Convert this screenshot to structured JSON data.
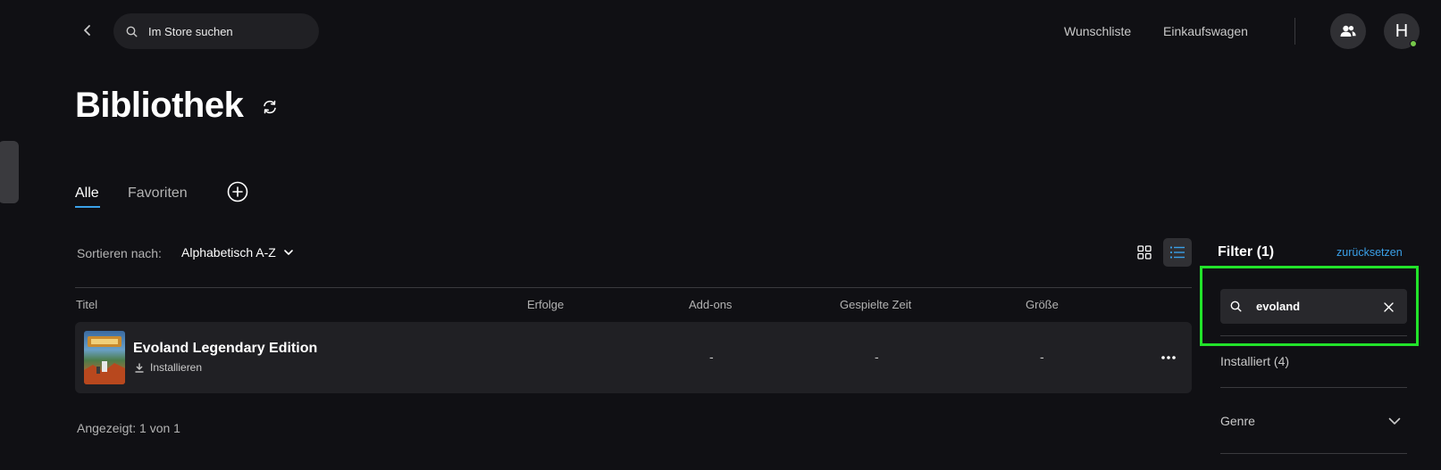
{
  "header": {
    "search_placeholder": "Im Store suchen",
    "wishlist": "Wunschliste",
    "cart": "Einkaufswagen",
    "avatar_letter": "H"
  },
  "page": {
    "title": "Bibliothek"
  },
  "tabs": [
    {
      "label": "Alle",
      "active": true
    },
    {
      "label": "Favoriten",
      "active": false
    }
  ],
  "sort": {
    "label": "Sortieren nach:",
    "value": "Alphabetisch A-Z"
  },
  "table": {
    "columns": [
      "Titel",
      "Erfolge",
      "Add-ons",
      "Gespielte Zeit",
      "Größe"
    ],
    "rows": [
      {
        "title": "Evoland Legendary Edition",
        "action": "Installieren",
        "addons": "-",
        "played_time": "-",
        "size": "-"
      }
    ]
  },
  "count_text": "Angezeigt: 1 von 1",
  "filter": {
    "title": "Filter (1)",
    "reset": "zurücksetzen",
    "search_value": "evoland",
    "installed": "Installiert (4)",
    "genre": "Genre"
  },
  "colors": {
    "background": "#101014",
    "accent": "#3aa0e8",
    "highlight": "#22e32a",
    "online": "#76c94a"
  }
}
